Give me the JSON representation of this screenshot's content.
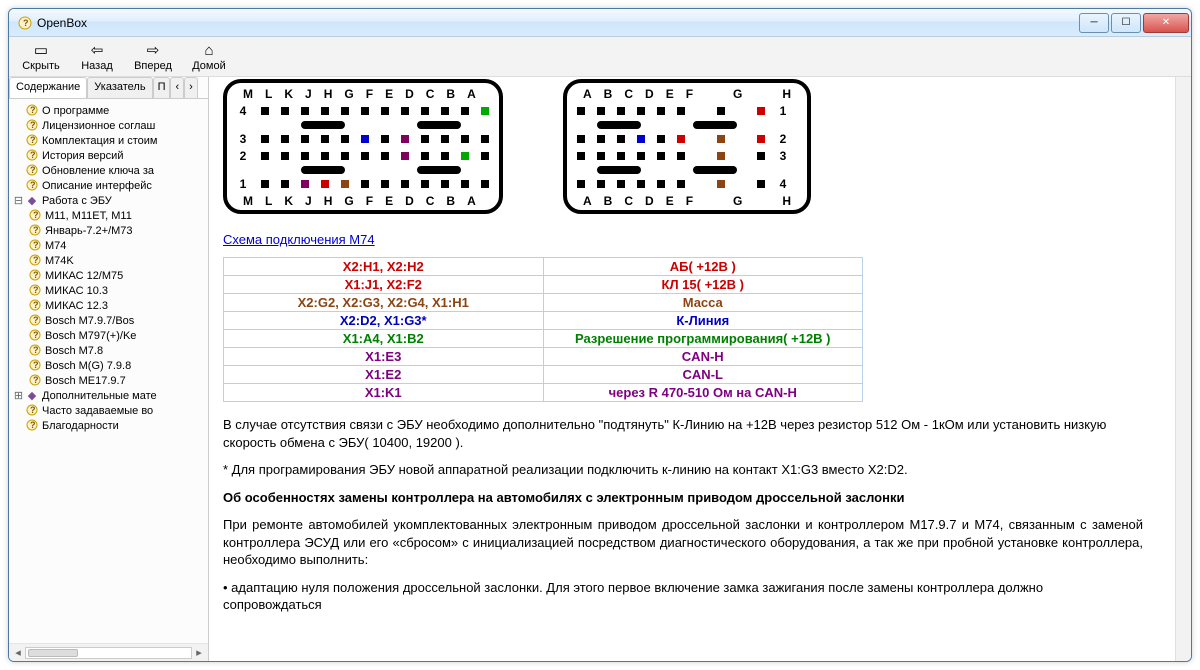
{
  "window": {
    "title": "OpenBox"
  },
  "toolbar": {
    "hide": "Скрыть",
    "back": "Назад",
    "forward": "Вперед",
    "home": "Домой"
  },
  "tabs": {
    "contents": "Содержание",
    "index": "Указатель",
    "s1": "П",
    "s2": "‹",
    "s3": "›"
  },
  "tree": {
    "about": "О программе",
    "license": "Лицензионное соглаш",
    "kit": "Комплектация и стоим",
    "history": "История версий",
    "keyupd": "Обновление ключа за",
    "iface": "Описание интерфейс",
    "ecu": "Работа с ЭБУ",
    "ecu_items": {
      "m11": "M11, M11ET, M11",
      "jan": "Январь-7.2+/M73",
      "m74": "M74",
      "m74k": "M74K",
      "mikas12": "МИКАС 12/M75",
      "mikas103": "МИКАС 10.3",
      "mikas123": "МИКАС 12.3",
      "bm797": "Bosch M7.9.7/Bos",
      "bm797k": "Bosch M797(+)/Ke",
      "bm78": "Bosch M7.8",
      "bmg798": "Bosch M(G) 7.9.8",
      "bme1797": "Bosch ME17.9.7"
    },
    "extra": "Дополнительные мате",
    "faq": "Часто задаваемые во",
    "thanks": "Благодарности"
  },
  "connector": {
    "top_labels_left": [
      "M",
      "L",
      "K",
      "J",
      "H",
      "G",
      "F",
      "E",
      "D",
      "C",
      "B",
      "A"
    ],
    "top_labels_right": [
      "A",
      "B",
      "C",
      "D",
      "E",
      "F",
      "G",
      "H"
    ],
    "rows": [
      "4",
      "3",
      "2",
      "1"
    ]
  },
  "scheme_link": "Схема подключения М74",
  "wiring": [
    {
      "l": "X2:H1, X2:H2",
      "r": "АБ( +12В )",
      "cls": "c-red-b"
    },
    {
      "l": "X1:J1, X2:F2",
      "r": "КЛ 15( +12В )",
      "cls": "c-red-b"
    },
    {
      "l": "X2:G2, X2:G3, X2:G4, X1:H1",
      "r": "Масса",
      "cls": "c-brown"
    },
    {
      "l": "X2:D2, X1:G3*",
      "r": "К-Линия",
      "cls": "c-blue"
    },
    {
      "l": "X1:A4, X1:B2",
      "r": "Разрешение программирования( +12В )",
      "cls": "c-green"
    },
    {
      "l": "X1:E3",
      "r": "CAN-H",
      "cls": "c-mag"
    },
    {
      "l": "X1:E2",
      "r": "CAN-L",
      "cls": "c-mag"
    },
    {
      "l": "X1:K1",
      "r": "через R 470-510 Ом на CAN-H",
      "cls": "c-mag"
    }
  ],
  "body": {
    "p1": "В случае отсутствия связи с ЭБУ необходимо дополнительно \"подтянуть\" К-Линию на +12В через резистор 512 Ом - 1кОм или установить низкую скорость обмена с ЭБУ( 10400, 19200 ).",
    "p2": "* Для програмирования ЭБУ новой аппаратной реализации подключить к-линию на контакт X1:G3 вместо X2:D2.",
    "h": "Об особенностях замены контроллера на автомобилях с электронным приводом дроссельной заслонки",
    "p3": "При ремонте автомобилей укомплектованных электронным приводом дроссельной заслонки и контроллером М17.9.7 и М74, связанным с заменой контроллера ЭСУД или его «сбросом» с инициализацией посредством диагностического оборудования, а так же при пробной установке контроллера, необходимо выполнить:",
    "b1": "адаптацию нуля положения дроссельной заслонки. Для этого первое включение замка зажигания после замены контроллера должно сопровождаться"
  }
}
